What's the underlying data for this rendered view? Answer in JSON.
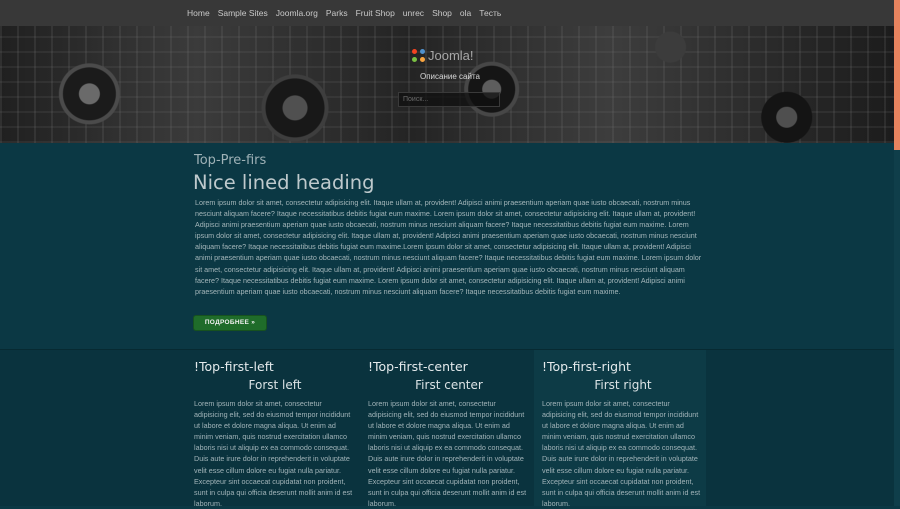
{
  "nav": {
    "items": [
      "Home",
      "Sample Sites",
      "Joomla.org",
      "Parks",
      "Fruit Shop",
      "unrec",
      "Shop",
      "ola",
      "Тесть"
    ]
  },
  "hero": {
    "logo_text": "Joomla!",
    "description": "Описание сайта",
    "search_placeholder": "Поиск..."
  },
  "top": {
    "prefix": "Top-Pre-firs",
    "heading": "Nice lined heading",
    "body": "Lorem ipsum dolor sit amet, consectetur adipisicing elit. Itaque ullam at, provident! Adipisci animi praesentium aperiam quae iusto obcaecati, nostrum minus nesciunt aliquam facere? Itaque necessitatibus debitis fugiat eum maxime. Lorem ipsum dolor sit amet, consectetur adipisicing elit. Itaque ullam at, provident! Adipisci animi praesentium aperiam quae iusto obcaecati, nostrum minus nesciunt aliquam facere? Itaque necessitatibus debitis fugiat eum maxime. Lorem ipsum dolor sit amet, consectetur adipisicing elit. Itaque ullam at, provident! Adipisci animi praesentium aperiam quae iusto obcaecati, nostrum minus nesciunt aliquam facere? Itaque necessitatibus debitis fugiat eum maxime.Lorem ipsum dolor sit amet, consectetur adipisicing elit. Itaque ullam at, provident! Adipisci animi praesentium aperiam quae iusto obcaecati, nostrum minus nesciunt aliquam facere? Itaque necessitatibus debitis fugiat eum maxime. Lorem ipsum dolor sit amet, consectetur adipisicing elit. Itaque ullam at, provident! Adipisci animi praesentium aperiam quae iusto obcaecati, nostrum minus nesciunt aliquam facere? Itaque necessitatibus debitis fugiat eum maxime. Lorem ipsum dolor sit amet, consectetur adipisicing elit. Itaque ullam at, provident! Adipisci animi praesentium aperiam quae iusto obcaecati, nostrum minus nesciunt aliquam facere? Itaque necessitatibus debitis fugiat eum maxime.",
    "button_label": "ПОДРОБНЕЕ »"
  },
  "columns": [
    {
      "title": "!Top-first-left",
      "subtitle": "Forst left",
      "text": "Lorem ipsum dolor sit amet, consectetur adipisicing elit, sed do eiusmod tempor incididunt ut labore et dolore magna aliqua. Ut enim ad minim veniam, quis nostrud exercitation ullamco laboris nisi ut aliquip ex ea commodo consequat. Duis aute irure dolor in reprehenderit in voluptate velit esse cillum dolore eu fugiat nulla pariatur. Excepteur sint occaecat cupidatat non proident, sunt in culpa qui officia deserunt mollit anim id est laborum."
    },
    {
      "title": "!Top-first-center",
      "subtitle": "First center",
      "text": "Lorem ipsum dolor sit amet, consectetur adipisicing elit, sed do eiusmod tempor incididunt ut labore et dolore magna aliqua. Ut enim ad minim veniam, quis nostrud exercitation ullamco laboris nisi ut aliquip ex ea commodo consequat. Duis aute irure dolor in reprehenderit in voluptate velit esse cillum dolore eu fugiat nulla pariatur. Excepteur sint occaecat cupidatat non proident, sunt in culpa qui officia deserunt mollit anim id est laborum."
    },
    {
      "title": "!Top-first-right",
      "subtitle": "First right",
      "text": "Lorem ipsum dolor sit amet, consectetur adipisicing elit, sed do eiusmod tempor incididunt ut labore et dolore magna aliqua. Ut enim ad minim veniam, quis nostrud exercitation ullamco laboris nisi ut aliquip ex ea commodo consequat. Duis aute irure dolor in reprehenderit in voluptate velit esse cillum dolore eu fugiat nulla pariatur. Excepteur sint occaecat cupidatat non proident, sunt in culpa qui officia deserunt mollit anim id est laborum."
    }
  ]
}
